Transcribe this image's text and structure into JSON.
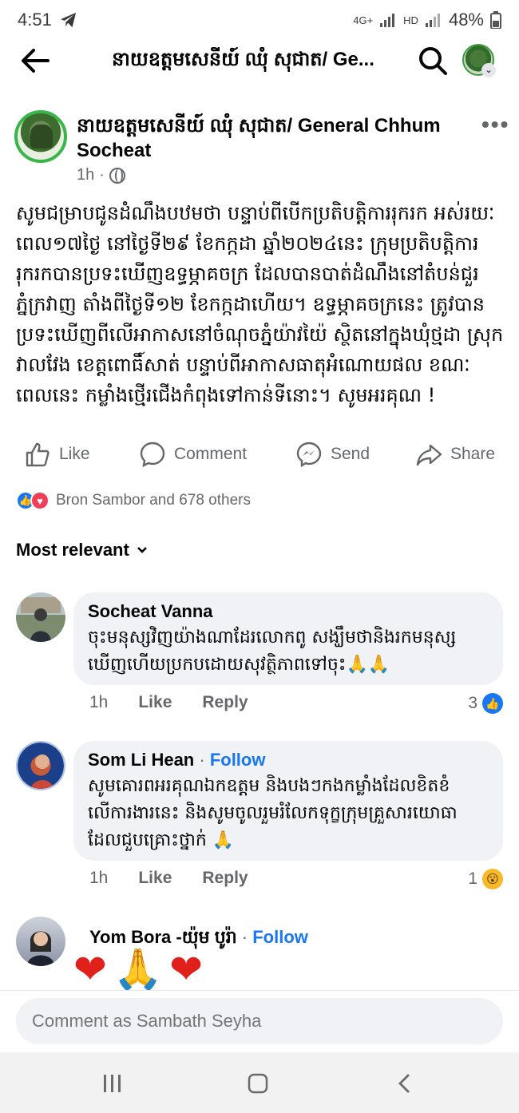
{
  "status_bar": {
    "time": "4:51",
    "network": "4G+",
    "hd": "HD",
    "battery": "48%"
  },
  "nav": {
    "title": "នាយឧត្តមសេនីយ៍ ឈុំ សុជាត/ Ge..."
  },
  "post": {
    "author": "នាយឧត្តមសេនីយ៍ ឈុំ សុជាត/ General Chhum Socheat",
    "time": "1h",
    "dot": "·",
    "body": "សូមជម្រាបជូនដំណឹងបឋមថា បន្ទាប់ពីបើកប្រតិបត្តិការរុករក អស់រយៈពេល១៧ថ្ងៃ នៅថ្ងៃទី២៩ ខែកក្កដា ឆ្នាំ២០២៤នេះ ក្រុមប្រតិបត្តិការរុករកបានប្រទះឃើញឧទ្ធម្ភាគចក្រ ដែលបានបាត់ដំណឹងនៅតំបន់ជួរភ្នំក្រវាញ តាំងពីថ្ងៃទី១២ ខែកក្កដាហើយ។ ឧទ្ធម្ភាគចក្រនេះ ត្រូវបានប្រទះឃើញពីលើអាកាសនៅចំណុចភ្នំយ៉ាវយ៉ៃ ស្ថិតនៅក្នុងឃុំថ្មដា ស្រុកវាលវែង ខេត្តពោធិ៍សាត់ បន្ទាប់ពីអាកាសធាតុអំណោយផល ខណៈពេលនេះ កម្លាំងថ្មើរជើងកំពុងទៅកាន់ទីនោះ។ សូមអរគុណ !"
  },
  "actions": {
    "like": "Like",
    "comment": "Comment",
    "send": "Send",
    "share": "Share"
  },
  "reactions": {
    "summary": "Bron Sambor and 678 others"
  },
  "sort": {
    "label": "Most relevant"
  },
  "comments": [
    {
      "name": "Socheat Vanna",
      "follow": "",
      "text": "ចុះមនុស្សវិញយ៉ាងណាដែរលោកពូ សង្ឃឹមថានិងរកមនុស្សឃើញហើយប្រកបដោយសុវត្ថិភាពទៅចុះ🙏🙏",
      "time": "1h",
      "like": "Like",
      "reply": "Reply",
      "count": "3"
    },
    {
      "name": "Som Li Hean",
      "follow": "Follow",
      "text": "សូមគោរពអរគុណឯកឧត្តម និងបងៗកងកម្លាំងដែលខិតខំលើការងារនេះ និងសូមចូលរួមរំលែកទុក្ខក្រុមគ្រួសារយោធាដែលជួបគ្រោះថ្នាក់ 🙏",
      "time": "1h",
      "like": "Like",
      "reply": "Reply",
      "count": "1"
    },
    {
      "name": "Yom Bora -យ៉ុម បូរ៉ា",
      "follow": "Follow",
      "emoji_1": "❤",
      "emoji_2": "🙏",
      "emoji_3": "❤"
    }
  ],
  "compose": {
    "placeholder": "Comment as Sambath Seyha"
  },
  "colors": {
    "accent": "#1877f2",
    "love": "#f33e58",
    "avatar_ring": "#39b54a"
  }
}
